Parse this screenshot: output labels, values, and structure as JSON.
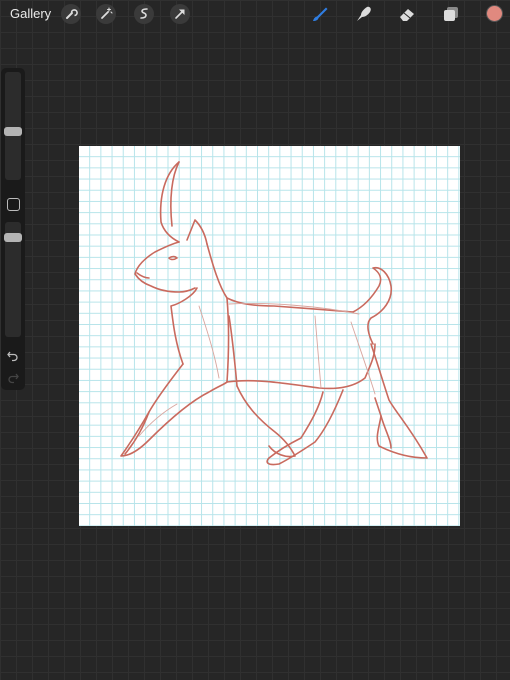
{
  "topbar": {
    "gallery_label": "Gallery",
    "left_tools": [
      "wrench-icon",
      "magic-wand-icon",
      "selection-icon",
      "transform-arrow-icon"
    ],
    "right_tools": [
      "brush-icon",
      "smudge-icon",
      "eraser-icon",
      "layers-icon"
    ],
    "active_tool": "brush-icon",
    "active_tool_color": "#2f7de1",
    "current_color": "#e0897f"
  },
  "sidebar": {
    "brush_size_level": 0.44,
    "opacity_level": 0.1,
    "buttons": [
      "modify-square-icon",
      "undo-icon",
      "redo-icon"
    ]
  },
  "canvas": {
    "paper": "white",
    "grid_color": "#b6e4ea",
    "sketch": "animal-sketch",
    "sketch_color": "#c96a5e"
  }
}
